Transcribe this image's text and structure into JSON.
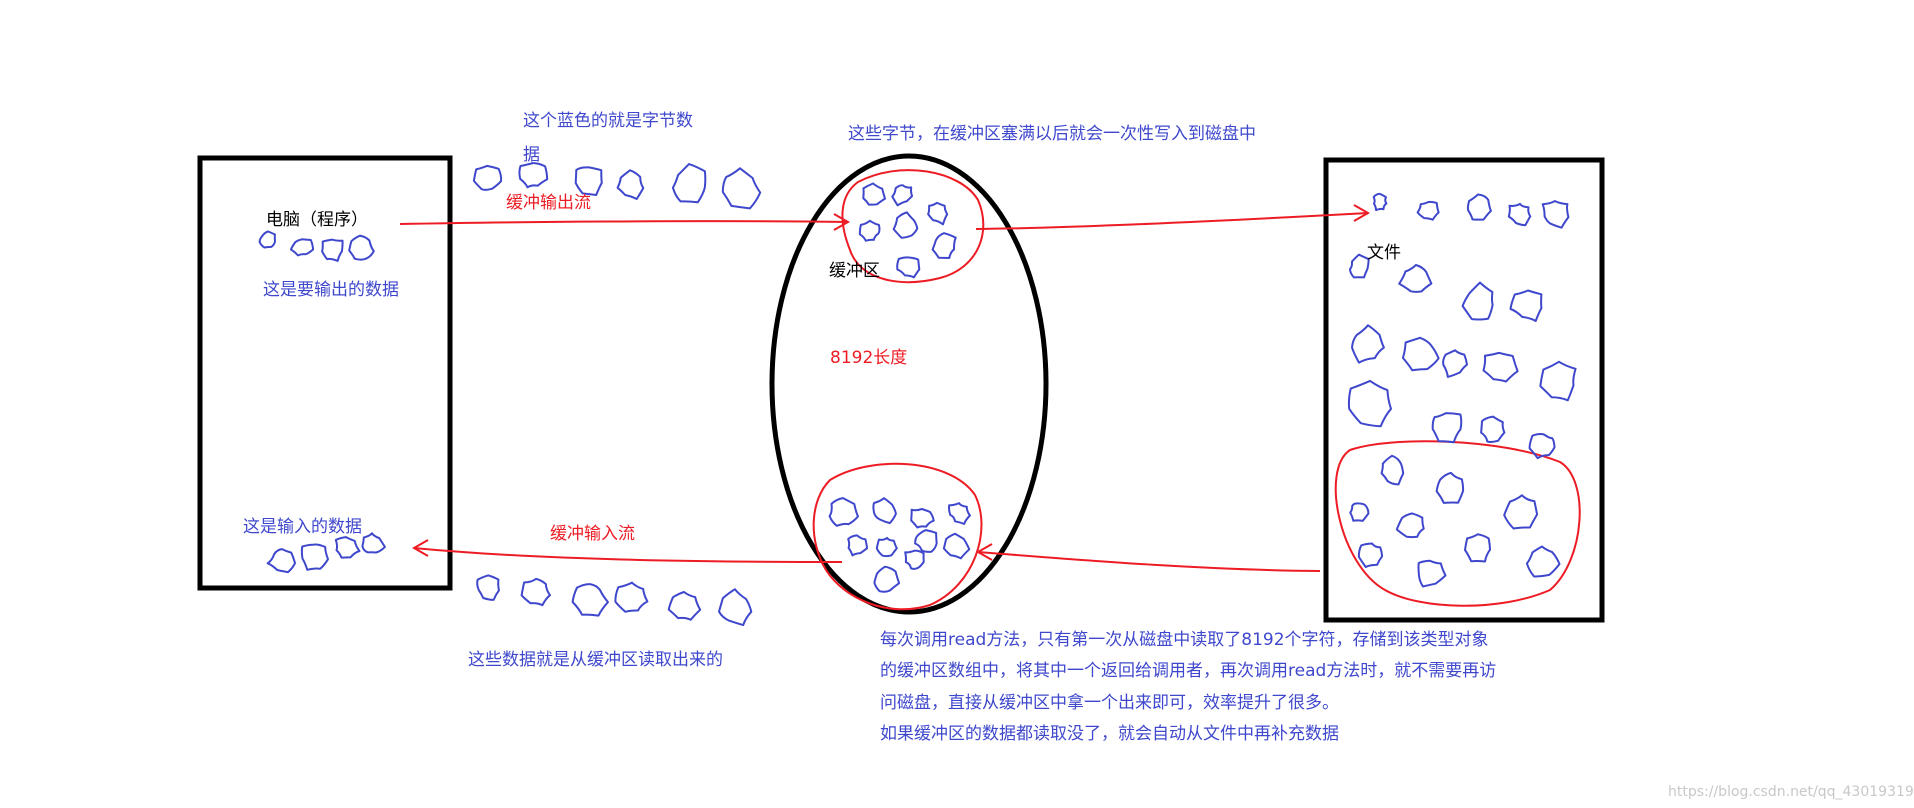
{
  "labels": {
    "computer": "电脑（程序）",
    "output_data": "这是要输出的数据",
    "input_data": "这是输入的数据",
    "blue_note_line1": "这个蓝色的就是字节数",
    "blue_note_line2": "据",
    "buffer_write_note": "这些字节，在缓冲区塞满以后就会一次性写入到磁盘中",
    "buffered_output_stream": "缓冲输出流",
    "buffered_input_stream": "缓冲输入流",
    "buffer": "缓冲区",
    "buffer_length": "8192长度",
    "file": "文件",
    "read_from_buffer": "这些数据就是从缓冲区读取出来的",
    "explanation": [
      "每次调用read方法，只有第一次从磁盘中读取了8192个字符，存储到该类型对象",
      "的缓冲区数组中，将其中一个返回给调用者，再次调用read方法时，就不需要再访",
      "问磁盘，直接从缓冲区中拿一个出来即可，效率提升了很多。",
      "如果缓冲区的数据都读取没了，就会自动从文件中再补充数据"
    ],
    "watermark": "https://blog.csdn.net/qq_43019319"
  },
  "colors": {
    "text_blue": "#3f48cc",
    "arrow_red": "#ed1c24",
    "outline_black": "#000000"
  }
}
